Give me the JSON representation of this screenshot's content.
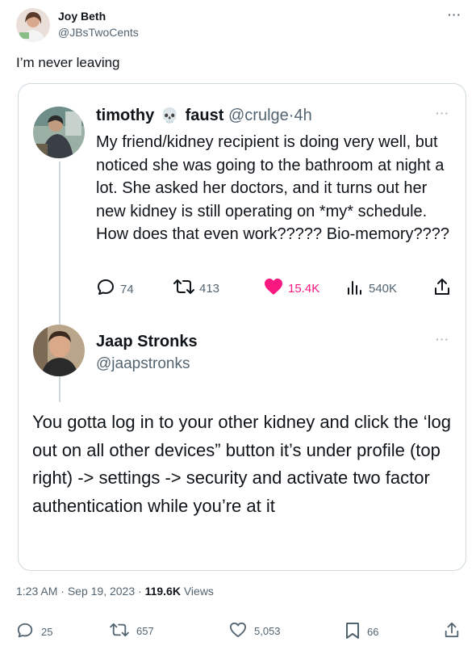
{
  "outer_tweet": {
    "author_name": "Joy Beth",
    "author_handle": "@JBsTwoCents",
    "more_glyph": "···",
    "text": "I’m never leaving",
    "time": "1:23 AM",
    "date": "Sep 19, 2023",
    "views_count": "119.6K",
    "views_label": "Views",
    "replies": "25",
    "retweets": "657",
    "likes": "5,053",
    "bookmarks": "66"
  },
  "quoted_tweet_1": {
    "author_name": "timothy",
    "emoji": "💀",
    "author_name_2": "faust",
    "author_handle": "@crulge",
    "separator": "·",
    "time": "4h",
    "more_glyph": "···",
    "text": "My friend/kidney recipient is doing very well, but noticed she was going to the bathroom at night a lot. She asked her doctors, and it turns out her new kidney is still operating on *my* schedule. How does that even work????? Bio-memory????",
    "replies": "74",
    "retweets": "413",
    "likes": "15.4K",
    "views": "540K"
  },
  "quoted_tweet_2": {
    "author_name": "Jaap Stronks",
    "author_handle": "@jaapstronks",
    "more_glyph": "···",
    "text": "You gotta log in to your other kidney and click the ‘log out on all other devices” button it’s under profile (top right) -> settings -> security and activate two factor authentication while you’re at it"
  },
  "colors": {
    "text_primary": "#0f1419",
    "text_secondary": "#536471",
    "border": "#cfd9de",
    "like_pink": "#f91880"
  },
  "icons": [
    "reply-icon",
    "retweet-icon",
    "like-icon",
    "views-icon",
    "share-icon",
    "bookmark-icon",
    "more-icon",
    "skull-emoji"
  ]
}
